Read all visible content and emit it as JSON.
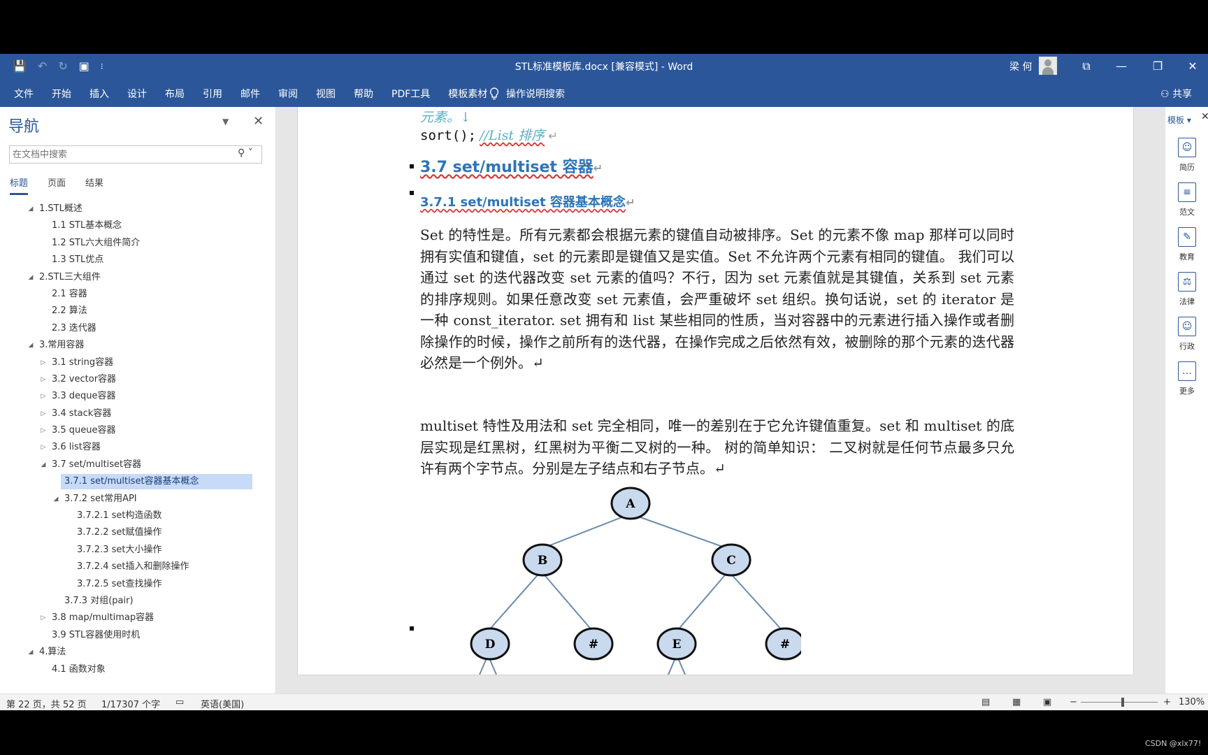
{
  "window": {
    "title": "STL标准模板库.docx [兼容模式]  -  Word",
    "user": "梁 何",
    "controls": [
      "⧉",
      "—",
      "❐",
      "✕"
    ]
  },
  "qat": {
    "save": "💾",
    "undo": "↶",
    "redo": "↻",
    "touch": "▣",
    "more": "⁝"
  },
  "ribbon": {
    "tabs": [
      "文件",
      "开始",
      "插入",
      "设计",
      "布局",
      "引用",
      "邮件",
      "审阅",
      "视图",
      "帮助",
      "PDF工具",
      "模板素材"
    ],
    "tell_me": "操作说明搜索",
    "share": "共享"
  },
  "nav": {
    "title": "导航",
    "search_placeholder": "在文档中搜索",
    "tabs": [
      "标题",
      "页面",
      "结果"
    ],
    "items": [
      {
        "label": "1.STL概述",
        "level": 1,
        "tri": "◢"
      },
      {
        "label": "1.1 STL基本概念",
        "level": 2,
        "tri": ""
      },
      {
        "label": "1.2 STL六大组件简介",
        "level": 2,
        "tri": ""
      },
      {
        "label": "1.3 STL优点",
        "level": 2,
        "tri": ""
      },
      {
        "label": "2.STL三大组件",
        "level": 1,
        "tri": "◢"
      },
      {
        "label": "2.1 容器",
        "level": 2,
        "tri": ""
      },
      {
        "label": "2.2 算法",
        "level": 2,
        "tri": ""
      },
      {
        "label": "2.3 迭代器",
        "level": 2,
        "tri": ""
      },
      {
        "label": "3.常用容器",
        "level": 1,
        "tri": "◢"
      },
      {
        "label": "3.1 string容器",
        "level": 2,
        "tri": "▷"
      },
      {
        "label": "3.2 vector容器",
        "level": 2,
        "tri": "▷"
      },
      {
        "label": "3.3 deque容器",
        "level": 2,
        "tri": "▷"
      },
      {
        "label": "3.4 stack容器",
        "level": 2,
        "tri": "▷"
      },
      {
        "label": "3.5 queue容器",
        "level": 2,
        "tri": "▷"
      },
      {
        "label": "3.6 list容器",
        "level": 2,
        "tri": "▷"
      },
      {
        "label": "3.7 set/multiset容器",
        "level": 2,
        "tri": "◢"
      },
      {
        "label": "3.7.1 set/multiset容器基本概念",
        "level": 3,
        "tri": "",
        "selected": true
      },
      {
        "label": "3.7.2 set常用API",
        "level": 3,
        "tri": "◢"
      },
      {
        "label": "3.7.2.1 set构造函数",
        "level": 4,
        "tri": ""
      },
      {
        "label": "3.7.2.2 set赋值操作",
        "level": 4,
        "tri": ""
      },
      {
        "label": "3.7.2.3 set大小操作",
        "level": 4,
        "tri": ""
      },
      {
        "label": "3.7.2.4 set插入和删除操作",
        "level": 4,
        "tri": ""
      },
      {
        "label": "3.7.2.5 set查找操作",
        "level": 4,
        "tri": ""
      },
      {
        "label": "3.7.3 对组(pair)",
        "level": 3,
        "tri": ""
      },
      {
        "label": "3.8 map/multimap容器",
        "level": 2,
        "tri": "▷"
      },
      {
        "label": "3.9 STL容器使用时机",
        "level": 2,
        "tri": ""
      },
      {
        "label": "4.算法",
        "level": 1,
        "tri": "◢"
      },
      {
        "label": "4.1 函数对象",
        "level": 2,
        "tri": ""
      }
    ]
  },
  "doc": {
    "prev_tail": "元素。↓",
    "code_line": "sort();",
    "code_comment": "//List 排序",
    "h2": "3.7 set/multiset 容器",
    "h3": "3.7.1 set/multiset 容器基本概念",
    "para1": "Set 的特性是。所有元素都会根据元素的键值自动被排序。Set 的元素不像 map 那样可以同时拥有实值和键值，set 的元素即是键值又是实值。Set 不允许两个元素有相同的键值。 我们可以通过 set 的迭代器改变 set 元素的值吗？不行，因为 set 元素值就是其键值，关系到 set 元素的排序规则。如果任意改变 set 元素值，会严重破坏 set 组织。换句话说，set 的 iterator 是一种 const_iterator. set 拥有和 list 某些相同的性质，当对容器中的元素进行插入操作或者删除操作的时候，操作之前所有的迭代器，在操作完成之后依然有效，被删除的那个元素的迭代器必然是一个例外。↵",
    "para2": "multiset 特性及用法和 set 完全相同，唯一的差别在于它允许键值重复。set 和 multiset 的底层实现是红黑树，红黑树为平衡二叉树的一种。 树的简单知识： 二叉树就是任何节点最多只允许有两个字节点。分别是左子结点和右子节点。↵",
    "para_mark": "↵",
    "tree_nodes": [
      "A",
      "B",
      "C",
      "D",
      "#",
      "E",
      "#"
    ]
  },
  "right_pane": {
    "title": "模板 ▾",
    "close": "✕",
    "items": [
      {
        "label": "简历",
        "icon": "resume-icon",
        "glyph": "☺"
      },
      {
        "label": "范文",
        "icon": "document-icon",
        "glyph": "≡"
      },
      {
        "label": "教育",
        "icon": "education-icon",
        "glyph": "✎"
      },
      {
        "label": "法律",
        "icon": "law-icon",
        "glyph": "⚖"
      },
      {
        "label": "行政",
        "icon": "admin-icon",
        "glyph": "☺"
      },
      {
        "label": "更多",
        "icon": "more-icon",
        "glyph": "…"
      }
    ]
  },
  "status": {
    "page": "第 22 页，共 52 页",
    "words": "1/17307 个字",
    "lang": "英语(美国)",
    "zoom": "130%",
    "zoom_minus": "−",
    "zoom_plus": "+"
  },
  "credit": "CSDN @xlx77!"
}
